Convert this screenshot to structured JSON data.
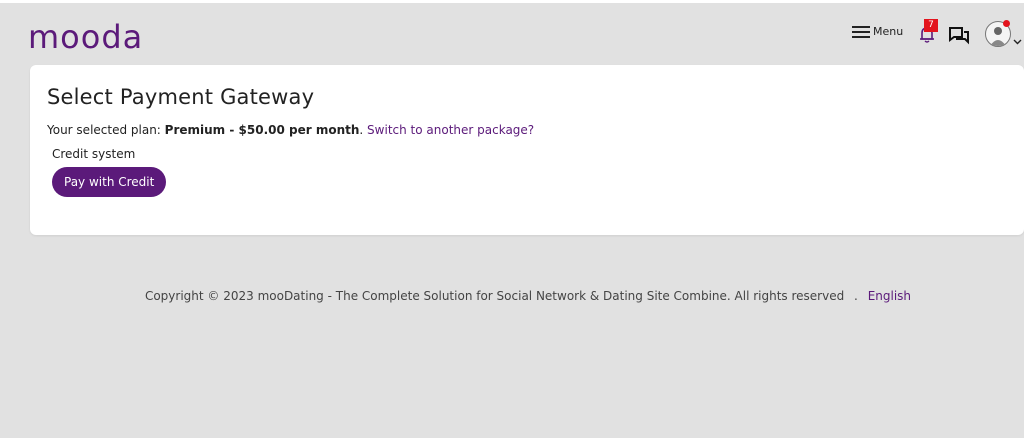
{
  "header": {
    "logo": "mooda",
    "menu_label": "Menu",
    "notification_count": "7",
    "icons": [
      "menu-icon",
      "bell-icon",
      "chat-icon",
      "avatar",
      "chevron-down-icon"
    ],
    "accent_color": "#5b1a7a",
    "badge_color": "#e3141d"
  },
  "main": {
    "title": "Select Payment Gateway",
    "plan_prefix": "Your selected plan: ",
    "plan_name": "Premium - $50.00 per month",
    "plan_suffix": ". ",
    "switch_link": "Switch to another package?",
    "gateway_label": "Credit system",
    "pay_button": "Pay with Credit"
  },
  "footer": {
    "copyright": "Copyright © 2023 mooDating - The Complete Solution for Social Network & Dating Site Combine. All rights reserved",
    "separator": ".",
    "language": "English"
  }
}
